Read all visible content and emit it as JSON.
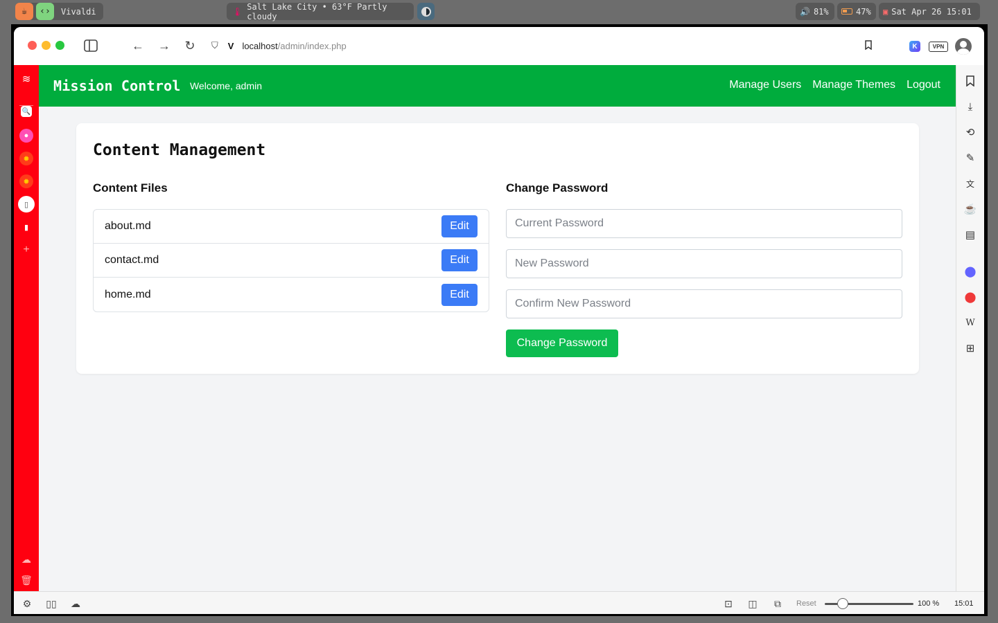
{
  "os_bar": {
    "app_name": "Vivaldi",
    "weather": "Salt Lake City • 63°F Partly cloudy",
    "volume": "81%",
    "battery": "47%",
    "datetime": "Sat Apr 26 15:01"
  },
  "browser": {
    "url_host": "localhost",
    "url_path": "/admin/index.php",
    "vpn_label": "VPN",
    "k_badge": "K"
  },
  "status_bar": {
    "reset_label": "Reset",
    "zoom": "100 %",
    "time": "15:01"
  },
  "site": {
    "brand": "Mission Control",
    "welcome": "Welcome, admin",
    "nav": {
      "manage_users": "Manage Users",
      "manage_themes": "Manage Themes",
      "logout": "Logout"
    },
    "colors": {
      "navbar": "#00ac3d",
      "edit_button": "#3b7bf6",
      "submit_button": "#0dbc50",
      "left_panel": "#ff0010"
    }
  },
  "content": {
    "title": "Content Management",
    "files_heading": "Content Files",
    "files": [
      {
        "name": "about.md",
        "action": "Edit"
      },
      {
        "name": "contact.md",
        "action": "Edit"
      },
      {
        "name": "home.md",
        "action": "Edit"
      }
    ],
    "password": {
      "heading": "Change Password",
      "current_placeholder": "Current Password",
      "new_placeholder": "New Password",
      "confirm_placeholder": "Confirm New Password",
      "submit_label": "Change Password"
    }
  }
}
